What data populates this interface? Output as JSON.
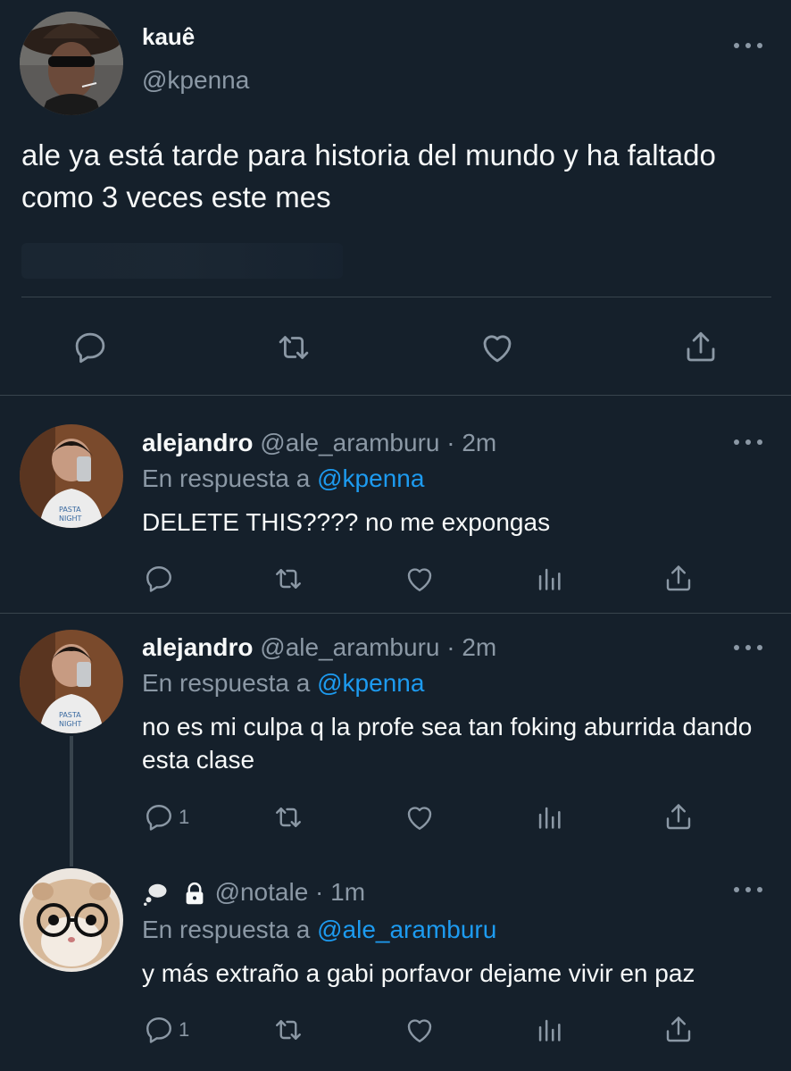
{
  "main_tweet": {
    "display_name": "kauê",
    "handle": "@kpenna",
    "text": "ale ya está tarde para historia del mundo y ha faltado como 3 veces este mes"
  },
  "replies": [
    {
      "display_name": "alejandro",
      "handle": "@ale_aramburu · 2m",
      "reply_prefix": "En respuesta a ",
      "reply_to": "@kpenna",
      "text": "DELETE THIS???? no me expongas",
      "reply_count": ""
    },
    {
      "display_name": "alejandro",
      "handle": "@ale_aramburu · 2m",
      "reply_prefix": "En respuesta a ",
      "reply_to": "@kpenna",
      "text": "no es mi culpa q la profe sea tan foking aburrida dando esta clase",
      "reply_count": "1"
    },
    {
      "display_name": "",
      "handle": "@notale · 1m",
      "reply_prefix": "En respuesta a ",
      "reply_to": "@ale_aramburu",
      "text": "y más extraño a gabi porfavor dejame vivir en paz",
      "reply_count": "1"
    }
  ],
  "colors": {
    "background": "#15202b",
    "text": "#f7f9f9",
    "secondary": "#8b98a5",
    "link": "#1d9bf0",
    "divider": "#38444d"
  },
  "icons": [
    "reply-icon",
    "retweet-icon",
    "like-icon",
    "share-icon",
    "analytics-icon",
    "more-icon",
    "lock-icon",
    "thought-bubble-icon"
  ]
}
